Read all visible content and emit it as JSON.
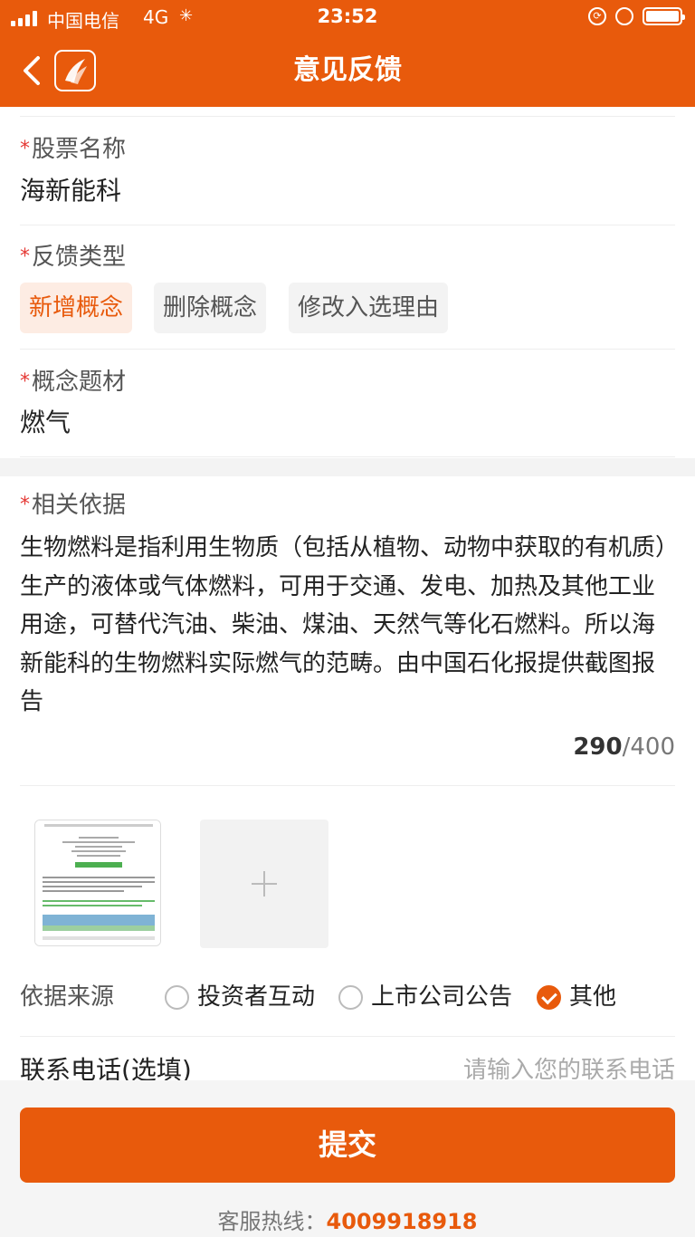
{
  "status_bar": {
    "carrier": "中国电信",
    "network": "4G",
    "time": "23:52"
  },
  "header": {
    "title": "意见反馈"
  },
  "form": {
    "stock": {
      "label": "股票名称",
      "value": "海新能科"
    },
    "type": {
      "label": "反馈类型",
      "options": [
        "新增概念",
        "删除概念",
        "修改入选理由"
      ],
      "selected": 0
    },
    "concept": {
      "label": "概念题材",
      "value": "燃气"
    },
    "basis": {
      "label": "相关依据",
      "text": "生物燃料是指利用生物质（包括从植物、动物中获取的有机质）生产的液体或气体燃料，可用于交通、发电、加热及其他工业用途，可替代汽油、柴油、煤油、天然气等化石燃料。所以海新能科的生物燃料实际燃气的范畴。由中国石化报提供截图报告",
      "count": "290",
      "max": "/400"
    },
    "source": {
      "label": "依据来源",
      "options": [
        "投资者互动",
        "上市公司公告",
        "其他"
      ],
      "selected": 2
    },
    "phone": {
      "label": "联系电话(选填)",
      "placeholder": "请输入您的联系电话",
      "value": ""
    }
  },
  "footer": {
    "submit_label": "提交",
    "hotline_label": "客服热线：",
    "hotline_number": "4009918918"
  },
  "colors": {
    "accent": "#e85a0c",
    "required": "#e53935"
  },
  "icons": [
    "back-arrow-icon",
    "app-logo-icon",
    "plus-icon",
    "check-icon"
  ]
}
